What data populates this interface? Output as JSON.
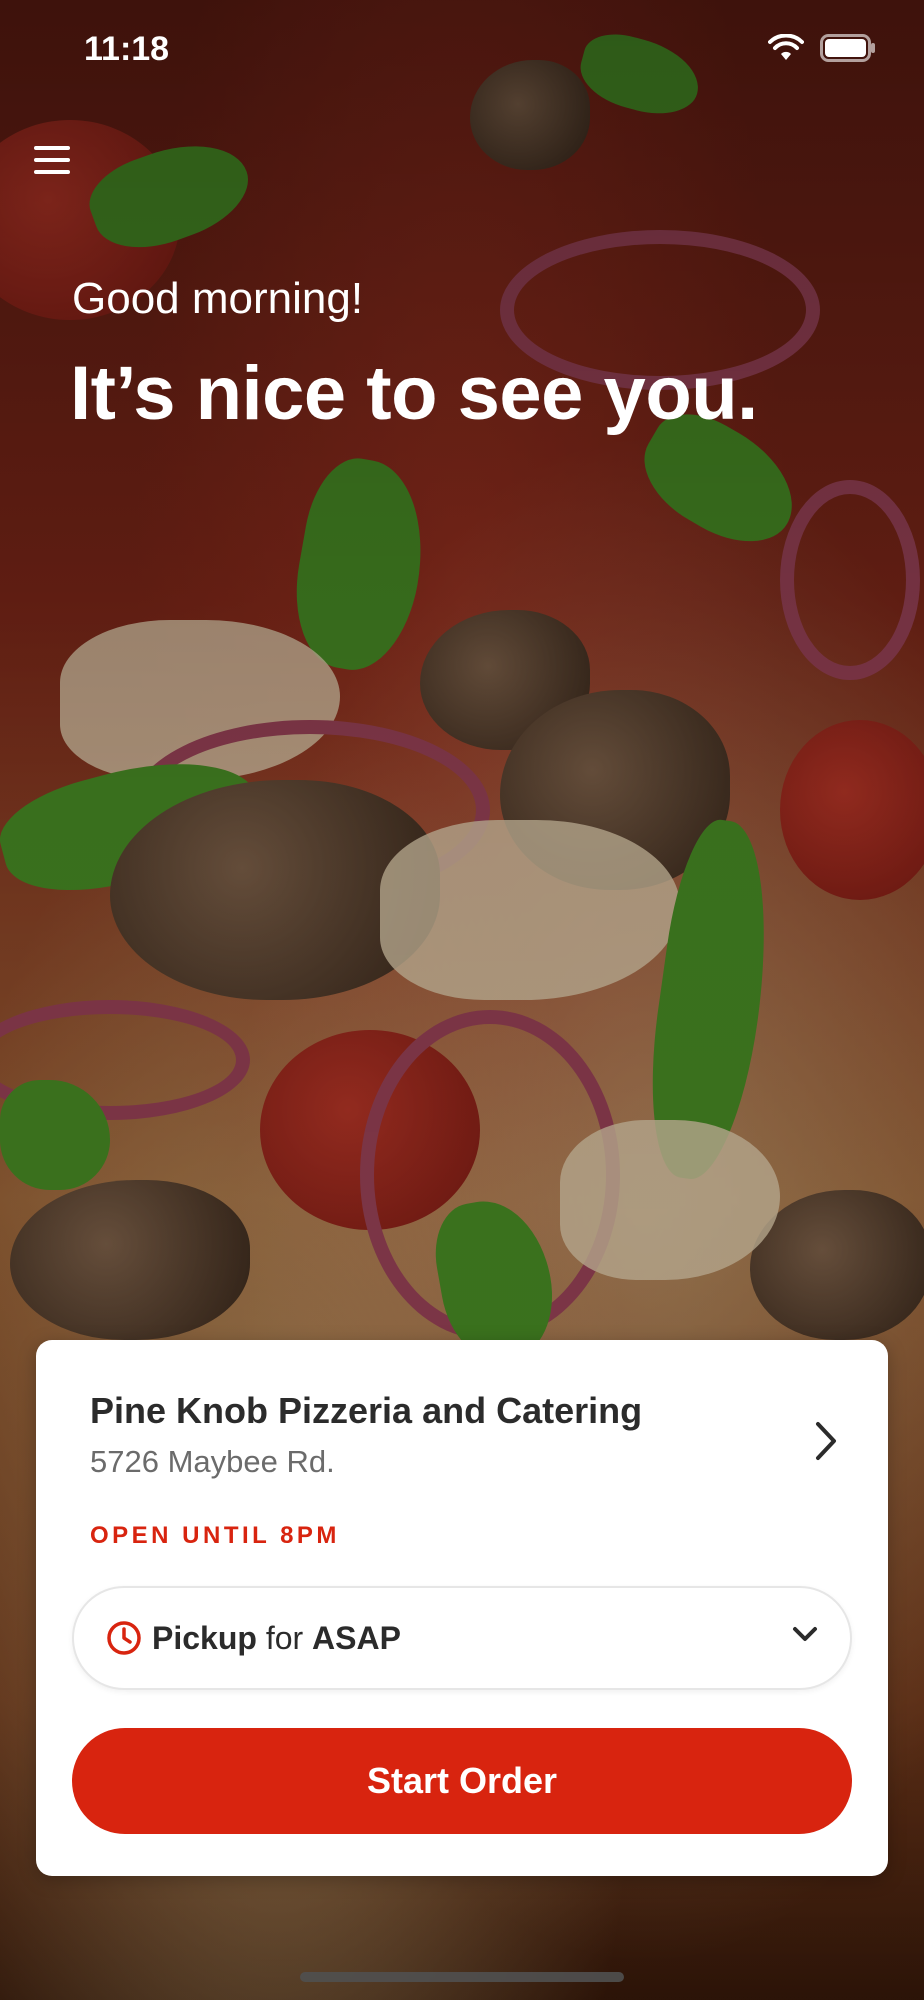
{
  "status_bar": {
    "time": "11:18",
    "icons": [
      "wifi-icon",
      "battery-icon"
    ]
  },
  "menu": {
    "icon": "hamburger-menu-icon"
  },
  "hero": {
    "greeting": "Good morning!",
    "headline": "It’s nice to see you."
  },
  "store": {
    "name": "Pine Knob Pizzeria and Catering",
    "address": "5726 Maybee Rd.",
    "status": "OPEN UNTIL 8PM"
  },
  "order": {
    "type": "Pickup",
    "connector": "for",
    "time": "ASAP"
  },
  "cta": {
    "label": "Start Order"
  },
  "colors": {
    "accent": "#d8240f",
    "text_primary": "#2b2b2b",
    "text_secondary": "#6b6b6b"
  }
}
